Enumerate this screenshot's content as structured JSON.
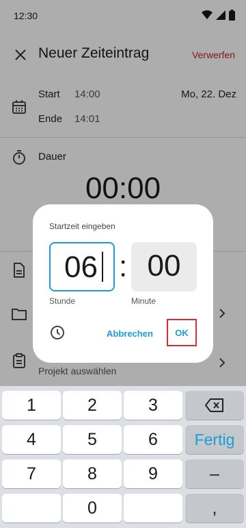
{
  "status": {
    "time": "12:30"
  },
  "appbar": {
    "title": "Neuer Zeiteintrag",
    "discard_label": "Verwerfen"
  },
  "entry": {
    "start_label": "Start",
    "start_time": "14:00",
    "end_label": "Ende",
    "end_time": "14:01",
    "date": "Mo, 22. Dez",
    "duration_label": "Dauer",
    "duration_value": "00:00",
    "project_placeholder": "Projekt auswählen"
  },
  "dialog": {
    "title": "Startzeit eingeben",
    "hour_value": "06",
    "minute_value": "00",
    "colon": ":",
    "hour_label": "Stunde",
    "minute_label": "Minute",
    "cancel_label": "Abbrechen",
    "ok_label": "OK"
  },
  "keyboard": {
    "keys": [
      "1",
      "2",
      "3",
      "4",
      "5",
      "6",
      "7",
      "8",
      "9",
      "0"
    ],
    "done_label": "Fertig",
    "minus_label": "–",
    "comma_label": ","
  },
  "colors": {
    "accent": "#1a9cd8",
    "discard": "#c5221f",
    "highlight": "#d32f2f"
  }
}
